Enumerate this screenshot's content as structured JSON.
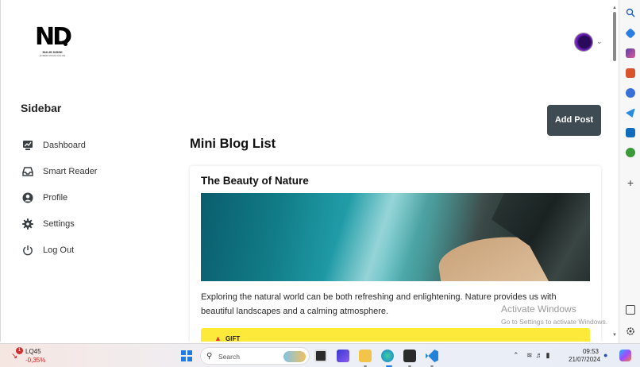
{
  "header": {
    "logo": {
      "mark": "ND",
      "name": "NULIS DISINI",
      "tagline": "LOREM IPSUM DOLOR"
    },
    "avatar_alt": "user avatar"
  },
  "sidebar": {
    "title": "Sidebar",
    "items": [
      {
        "label": "Dashboard",
        "icon": "dashboard-icon"
      },
      {
        "label": "Smart Reader",
        "icon": "inbox-icon"
      },
      {
        "label": "Profile",
        "icon": "user-circle-icon"
      },
      {
        "label": "Settings",
        "icon": "gear-icon"
      },
      {
        "label": "Log Out",
        "icon": "power-icon"
      }
    ]
  },
  "main": {
    "add_post_label": "Add Post",
    "title": "Mini Blog List",
    "posts": [
      {
        "title": "The Beauty of Nature",
        "image_alt": "aerial view of ocean waves on a rocky beach",
        "body": "Exploring the natural world can be both refreshing and enlightening. Nature provides us with beautiful landscapes and a calming atmosphere.",
        "gift_label": "GIFT"
      }
    ]
  },
  "watermark": {
    "title": "Activate Windows",
    "subtitle": "Go to Settings to activate Windows."
  },
  "taskbar": {
    "stock": {
      "badge": "1",
      "name": "LQ45",
      "change": "-0,35%"
    },
    "search_label": "Search",
    "clock": {
      "time": "09:53",
      "date": "21/07/2024"
    }
  },
  "colors": {
    "add_post_bg": "#3f4b52",
    "gift_bar": "#fde93a",
    "windows_blue": "#1e7be0"
  }
}
